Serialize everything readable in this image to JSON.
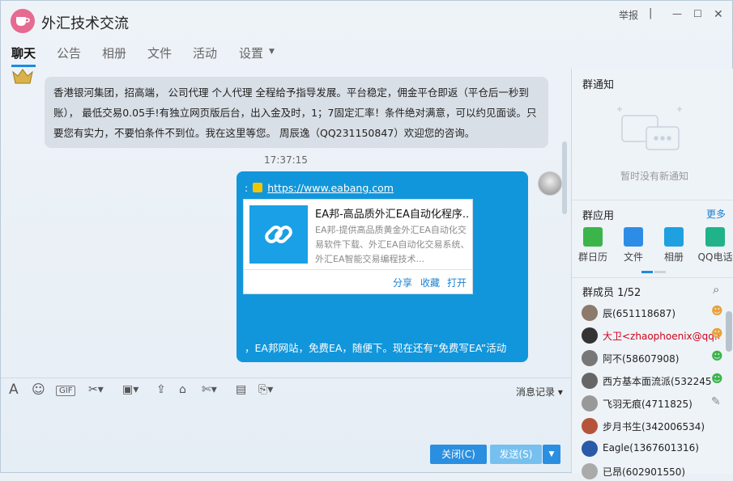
{
  "window": {
    "title": "外汇技术交流",
    "report_label": "举报"
  },
  "tabs": [
    "聊天",
    "公告",
    "相册",
    "文件",
    "活动",
    "设置"
  ],
  "messages": {
    "m1": "香港银河集团，招高端， 公司代理 个人代理 全程给予指导发展。平台稳定，佣金平仓即返（平仓后一秒到账）， 最低交易0.05手!有独立网页版后台，出入金及时，1；7固定汇率！条件绝对满意，可以约见面谈。只要您有实力，不要怕条件不到位。我在这里等您。 周辰逸（QQ231150847）欢迎您的咨询。",
    "time": "17:37:15",
    "m2_prefix": ":",
    "m2_link": "https://www.eabang.com",
    "card_title": "EA邦-高品质外汇EA自动化程序...",
    "card_desc": "EA邦-提供高品质黄金外汇EA自动化交易软件下载、外汇EA自动化交易系统、外汇EA智能交易编程技术...",
    "card_share": "分享",
    "card_fav": "收藏",
    "card_open": "打开",
    "m2_tail": "，EA邦网站，免费EA，随便下。现在还有“免费写EA”活动"
  },
  "toolbar": {
    "history": "消息记录"
  },
  "buttons": {
    "close": "关闭(C)",
    "send": "发送(S)"
  },
  "notice": {
    "title": "群通知",
    "empty": "暂时没有新通知"
  },
  "apps": {
    "title": "群应用",
    "more": "更多",
    "items": [
      {
        "label": "群日历",
        "color": "#3bb54a"
      },
      {
        "label": "文件",
        "color": "#2d8de6"
      },
      {
        "label": "相册",
        "color": "#1fa0e0"
      },
      {
        "label": "QQ电话",
        "color": "#20b38a"
      }
    ]
  },
  "members": {
    "title": "群成员 1/52",
    "items": [
      {
        "name": "辰(651118687)",
        "color": "#222"
      },
      {
        "name": "大卫<zhaophoenix@qq.co",
        "color": "#d0021b"
      },
      {
        "name": "阿不(58607908)",
        "color": "#222"
      },
      {
        "name": "西方基本面流派(532245",
        "color": "#222"
      },
      {
        "name": "飞羽无痕(4711825)",
        "color": "#222"
      },
      {
        "name": "步月书生(342006534)",
        "color": "#222"
      },
      {
        "name": "Eagle(1367601316)",
        "color": "#222"
      },
      {
        "name": "已昂(602901550)",
        "color": "#222"
      }
    ]
  }
}
